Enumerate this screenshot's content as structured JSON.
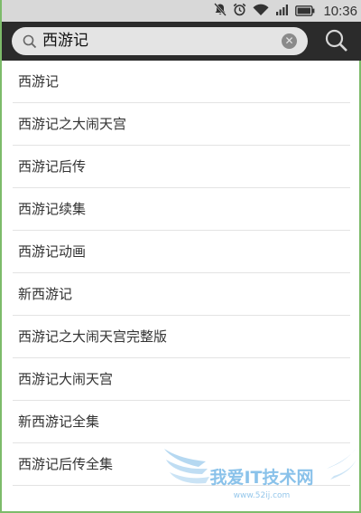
{
  "status_bar": {
    "time": "10:36",
    "icons": [
      "mute-icon",
      "alarm-icon",
      "wifi-icon",
      "signal-icon",
      "battery-icon"
    ]
  },
  "search": {
    "query": "西游记",
    "icons": {
      "field": "search-icon",
      "clear": "clear-icon",
      "submit": "search-icon"
    }
  },
  "suggestions": [
    "西游记",
    "西游记之大闹天宫",
    "西游记后传",
    "西游记续集",
    "西游记动画",
    "新西游记",
    "西游记之大闹天宫完整版",
    "西游记大闹天宫",
    "新西游记全集",
    "西游记后传全集"
  ],
  "watermark": {
    "title": "我爱IT技术网",
    "url": "www.52ij.com"
  },
  "colors": {
    "status_bar": "#d8d8d8",
    "search_bar": "#2b2b2b",
    "search_field": "#e4e4e4",
    "frame_border": "#7dbb6a",
    "watermark": "#2a8fd8"
  }
}
